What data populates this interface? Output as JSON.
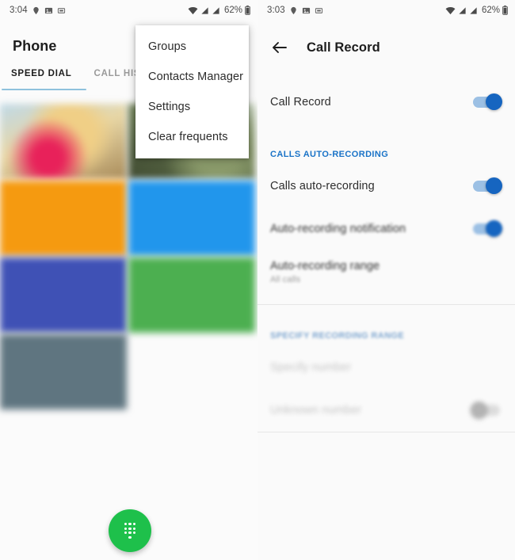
{
  "left": {
    "status_bar": {
      "time": "3:04",
      "battery": "62%",
      "icons": [
        "location-icon",
        "image-icon",
        "sim-card-icon",
        "wifi-icon",
        "signal-icon",
        "signal-icon-2",
        "battery-icon"
      ]
    },
    "title": "Phone",
    "tabs": [
      {
        "label": "SPEED DIAL",
        "active": true
      },
      {
        "label": "CALL HIS",
        "active": false
      }
    ],
    "menu": {
      "items": [
        {
          "label": "Groups"
        },
        {
          "label": "Contacts Manager"
        },
        {
          "label": "Settings"
        },
        {
          "label": "Clear frequents"
        }
      ]
    },
    "speed_dial": {
      "tiles": [
        {
          "name": "contact-tile-1",
          "style": "tile-photo-1",
          "label": ""
        },
        {
          "name": "contact-tile-2",
          "style": "tile-photo-2",
          "label": ""
        },
        {
          "name": "contact-tile-3",
          "style": "tile-orange",
          "label": ""
        },
        {
          "name": "contact-tile-4",
          "style": "tile-blue",
          "label": ""
        },
        {
          "name": "contact-tile-5",
          "style": "tile-indigo",
          "label": ""
        },
        {
          "name": "contact-tile-6",
          "style": "tile-green",
          "label": ""
        },
        {
          "name": "contact-tile-7",
          "style": "tile-slate",
          "label": ""
        }
      ]
    },
    "fab": {
      "icon": "dialpad-icon",
      "color": "#1ec04b"
    }
  },
  "right": {
    "status_bar": {
      "time": "3:03",
      "battery": "62%"
    },
    "appbar": {
      "back_icon": "back-arrow-icon",
      "title": "Call Record"
    },
    "accent_color": "#1a73c7",
    "switch_on_color": "#1665c0",
    "rows": {
      "call_record": {
        "label": "Call Record",
        "switch": "on"
      },
      "section_calls_auto": "CALLS AUTO-RECORDING",
      "calls_auto_recording": {
        "label": "Calls auto-recording",
        "switch": "on"
      },
      "auto_recording_notification": {
        "label": "Auto-recording notification",
        "switch": "on"
      },
      "auto_recording_range": {
        "label": "Auto-recording range",
        "sub": "All calls"
      },
      "section_specify": "SPECIFY RECORDING RANGE",
      "specify_number": {
        "label": "Specify number"
      },
      "unknown_number": {
        "label": "Unknown number",
        "switch": "off"
      }
    }
  }
}
